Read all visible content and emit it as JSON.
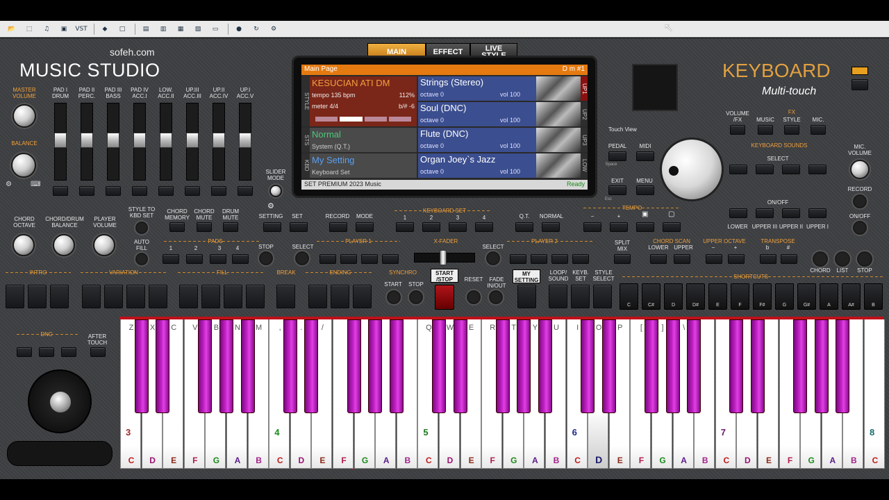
{
  "toolbar": {
    "icons": [
      "open-icon",
      "pdf-icon",
      "wav-icon",
      "save-icon",
      "vst-icon",
      "color-icon",
      "window-icon",
      "layout-icon",
      "layout2-icon",
      "layout3-icon",
      "layout4-icon",
      "midi-icon",
      "refresh-icon",
      "settings-icon"
    ],
    "vst_label": "VST"
  },
  "brand": {
    "site": "sofeh.com",
    "title": "MUSIC STUDIO",
    "keyboard": "KEYBOARD",
    "multitouch": "Multi-touch"
  },
  "mixer": {
    "master": "MASTER\nVOLUME",
    "balance": "BALANCE",
    "channels": [
      "PAD I\nDRUM",
      "PAD II\nPERC.",
      "PAD III\nBASS",
      "PAD IV\nACC.I",
      "LOW.\nACC.II",
      "UP.III\nACC.III",
      "UP.II\nACC.IV",
      "UP.I\nACC.V"
    ],
    "slider_mode": "SLIDER\nMODE"
  },
  "tabs": {
    "main": "MAIN",
    "effect": "EFFECT",
    "live": "LIVE\nSTYLE"
  },
  "display": {
    "header": "Main Page",
    "chord": "D m  #1",
    "style_name": "KESUCIAN ATI DM",
    "tempo": "tempo 135 bpm",
    "percent": "112%",
    "meter": "meter 4/4",
    "transpose": "b/# -6",
    "sts_name": "Normal",
    "sts_sub": "System (Q.T.)",
    "kbd_name": "My Setting",
    "kbd_sub": "Keyboard Set",
    "side_style": "STYLE",
    "side_sts": "STS",
    "side_kbd": "KBD",
    "slots": [
      {
        "name": "Strings (Stereo)",
        "octave": "octave 0",
        "vol": "vol 100",
        "side": "UP1"
      },
      {
        "name": "Soul (DNC)",
        "octave": "octave 0",
        "vol": "vol 100",
        "side": "UP2"
      },
      {
        "name": "Flute (DNC)",
        "octave": "octave 0",
        "vol": "vol 100",
        "side": "UP3"
      },
      {
        "name": "Organ Joey`s Jazz",
        "octave": "octave 0",
        "vol": "vol 100",
        "side": "LOW"
      }
    ],
    "footer": "SET PREMIUM 2023 Music",
    "status": "Ready"
  },
  "right": {
    "volume_fx": "VOLUME\n/FX",
    "fx": "FX",
    "music": "MUSIC",
    "style": "STYLE",
    "mic": "MIC.",
    "touch_view": "Touch View",
    "pedal": "PEDAL",
    "midi": "MIDI",
    "space": "Space",
    "exit": "EXIT",
    "menu": "MENU",
    "esc": "Esc",
    "keyboard_sounds": "KEYBOARD SOUNDS",
    "select": "SELECT",
    "onoff": "ON/OFF",
    "sound_labels": [
      "LOWER",
      "UPPER III",
      "UPPER II",
      "UPPER I"
    ],
    "mic_volume": "MIC.\nVOLUME",
    "record": "RECORD",
    "mic_onoff": "ON/OFF"
  },
  "middle": {
    "chord_octave": "CHORD\nOCTAVE",
    "chord_drum_balance": "CHORD/DRUM\nBALANCE",
    "player_volume": "PLAYER\nVOLUME",
    "style_to_kbd": "STYLE TO\nKBD SET",
    "chord_memory": "CHORD\nMEMORY",
    "chord_mute": "CHORD\nMUTE",
    "drum_mute": "DRUM\nMUTE",
    "setting": "SETTING",
    "set": "SET",
    "record": "RECORD",
    "mode": "MODE",
    "keyboard_set": "KEYBOARD SET",
    "kbset_nums": [
      "1",
      "2",
      "3",
      "4"
    ],
    "qt": "Q.T.",
    "normal": "NORMAL",
    "tempo": "TEMPO",
    "auto_fill": "AUTO\nFILL",
    "pads": "PADS",
    "pad_nums": [
      "1",
      "2",
      "3",
      "4"
    ],
    "stop": "STOP",
    "select": "SELECT",
    "player1": "PLAYER 1",
    "xfader": "X-FADER",
    "player2": "PLAYER 2",
    "split_mix": "SPLIT\nMIX",
    "chord_scan": "CHORD SCAN",
    "lower": "LOWER",
    "upper": "UPPER",
    "upper_octave": "UPPER OCTAVE",
    "transpose": "TRANSPOSE",
    "chord": "CHORD",
    "list": "LIST",
    "stop2": "STOP"
  },
  "sections": {
    "intro": "INTRO",
    "variation": "VARIATION",
    "fill": "FILL",
    "break": "BREAK",
    "ending": "ENDING",
    "synchro": "SYNCHRO",
    "start": "START",
    "stop": "STOP",
    "start_stop": "START\n/STOP",
    "reset": "RESET",
    "fade": "FADE\nIN/OUT",
    "my_setting": "MY\nSETTING",
    "loop_sound": "LOOP/\nSOUND",
    "keyb_set": "KEYB.\nSET",
    "style_select": "STYLE\nSELECT",
    "shortcuts": "SHORTCUTS",
    "dnc": "DNC",
    "after_touch": "AFTER\nTOUCH"
  },
  "keys": {
    "white_notes": [
      "C",
      "D",
      "E",
      "F",
      "G",
      "A",
      "B",
      "C",
      "D",
      "E",
      "F",
      "G",
      "A",
      "B",
      "C",
      "D",
      "E",
      "F",
      "G",
      "A",
      "B",
      "C",
      "D",
      "E",
      "F",
      "G",
      "A",
      "B",
      "C",
      "D",
      "E",
      "F",
      "G",
      "A",
      "B",
      "C"
    ],
    "top_letters": [
      "Z",
      "X",
      "C",
      "V",
      "B",
      "N",
      "M",
      ",",
      ".",
      "/",
      "",
      "",
      "",
      "",
      "Q",
      "W",
      "E",
      "R",
      "T",
      "Y",
      "U",
      "I",
      "O",
      "P",
      "[",
      "]",
      "\\",
      "",
      "",
      "",
      "",
      "",
      "",
      "",
      "",
      ""
    ],
    "octave_nums": [
      "3",
      "4",
      "5",
      "6",
      "7",
      "8"
    ],
    "shortcut_labels": [
      "C",
      "C#",
      "D",
      "D#",
      "E",
      "F",
      "F#",
      "G",
      "G#",
      "A",
      "A#",
      "B"
    ]
  }
}
